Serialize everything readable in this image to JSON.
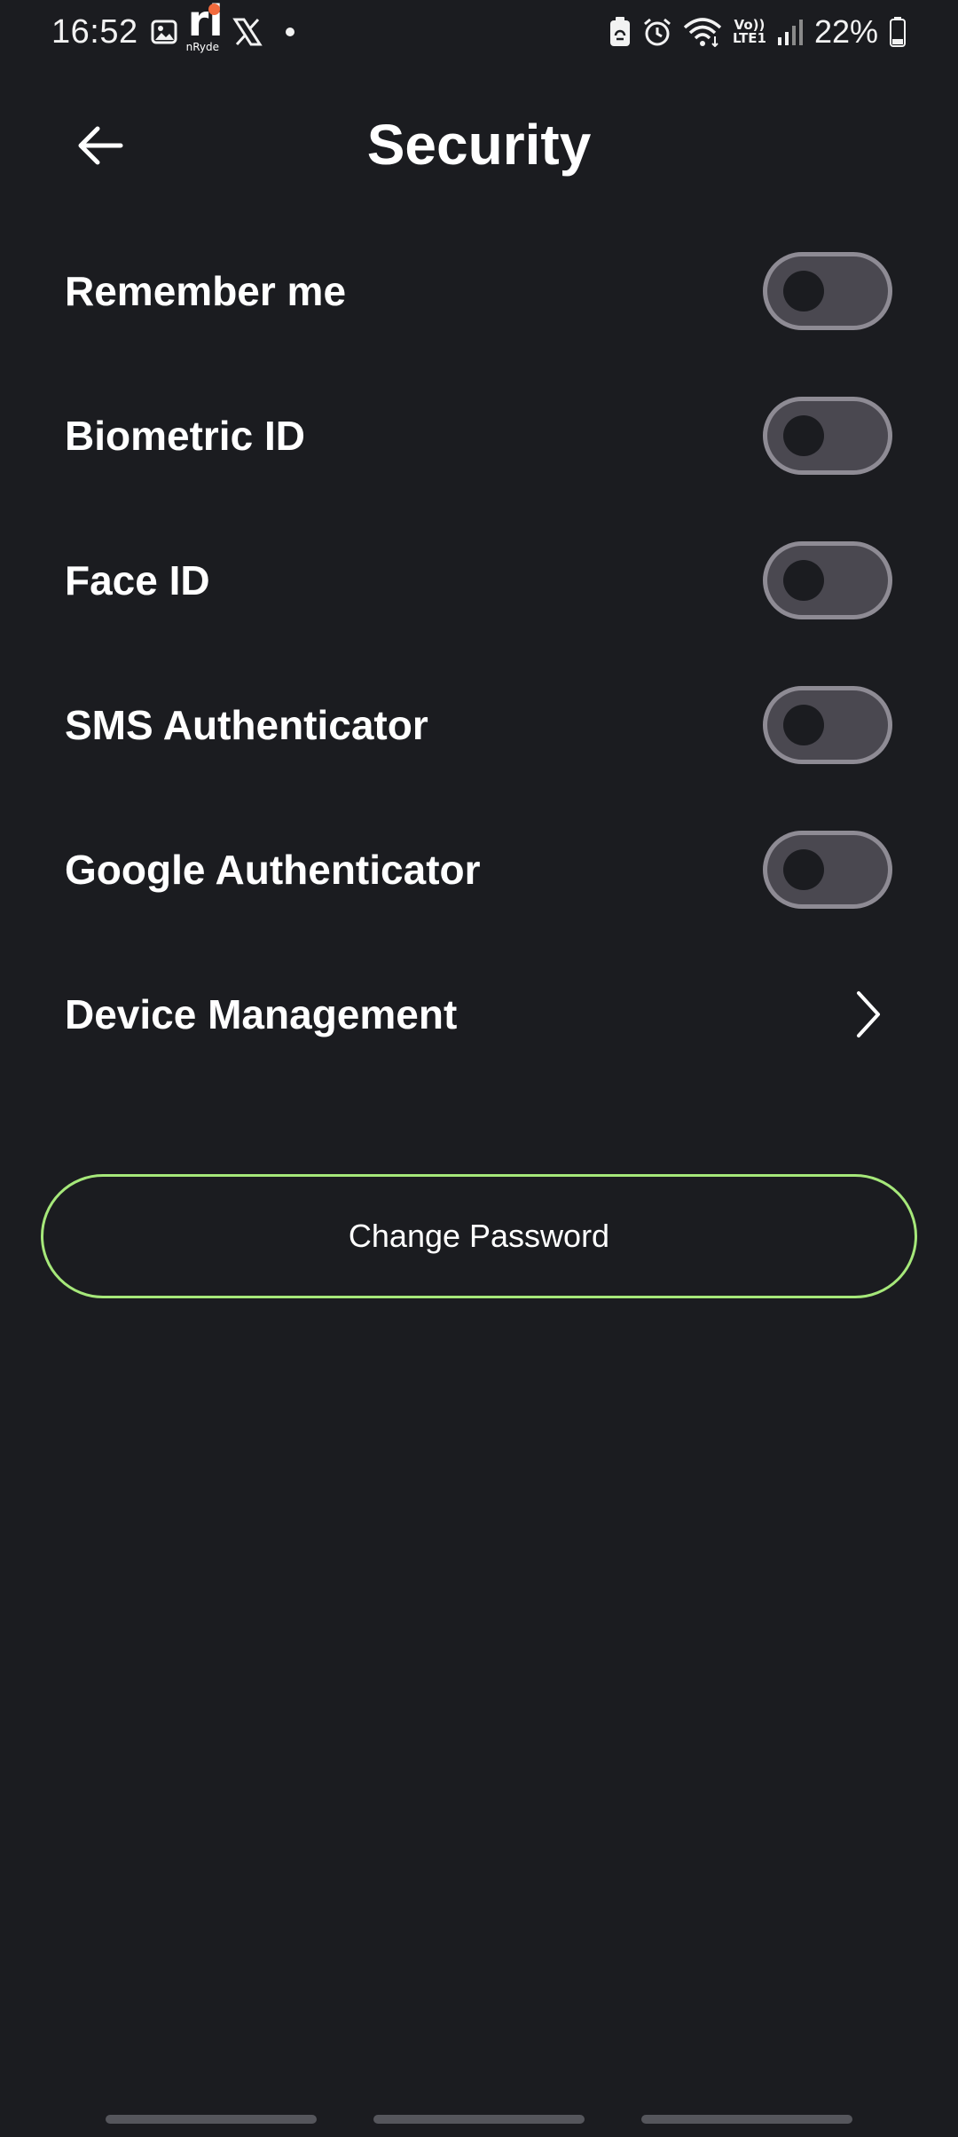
{
  "status_bar": {
    "time": "16:52",
    "app_name": "nRyde",
    "app_letters": "ri",
    "volte_top": "Vo))",
    "volte_bottom": "LTE1",
    "battery_percent": "22%",
    "icons": [
      "gallery-icon",
      "nryde-app-icon",
      "x-icon",
      "notification-dot",
      "battery-saver-icon",
      "alarm-icon",
      "wifi-icon",
      "signal-icon",
      "battery-icon"
    ]
  },
  "header": {
    "title": "Security",
    "back_icon": "arrow-left-icon"
  },
  "settings": [
    {
      "label": "Remember me",
      "type": "toggle",
      "enabled": false
    },
    {
      "label": "Biometric ID",
      "type": "toggle",
      "enabled": false
    },
    {
      "label": "Face ID",
      "type": "toggle",
      "enabled": false
    },
    {
      "label": "SMS Authenticator",
      "type": "toggle",
      "enabled": false
    },
    {
      "label": "Google Authenticator",
      "type": "toggle",
      "enabled": false
    },
    {
      "label": "Device Management",
      "type": "link",
      "icon": "chevron-right-icon"
    }
  ],
  "change_password": {
    "label": "Change Password"
  },
  "colors": {
    "background": "#1b1c20",
    "text": "#ffffff",
    "toggle_track": "#4a4850",
    "toggle_border": "#8e8b94",
    "accent_border": "#a6e87a",
    "nav_handle": "#55565c"
  }
}
